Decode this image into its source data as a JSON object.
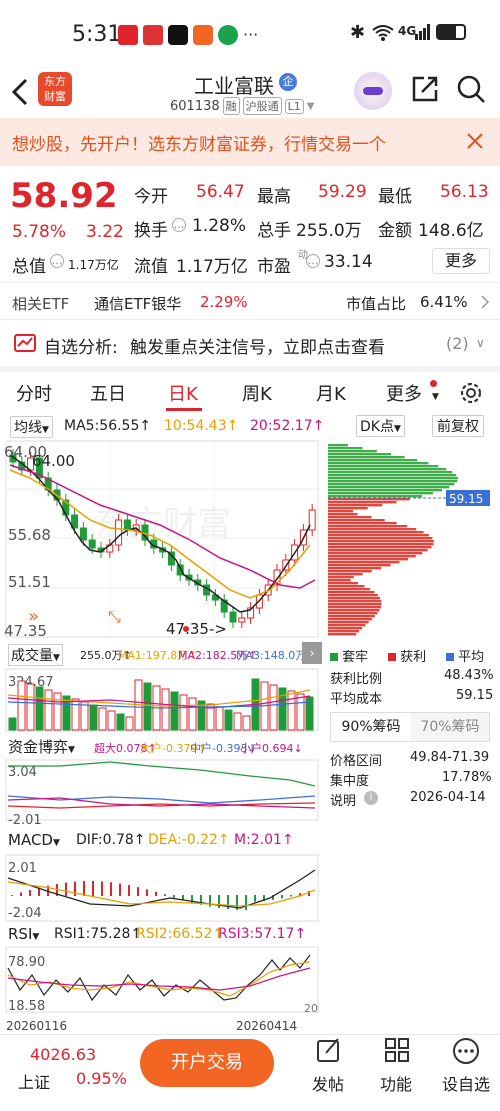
{
  "status": {
    "time": "5:31",
    "signal": "4G",
    "battery": "75"
  },
  "header": {
    "logo_line1": "东方",
    "logo_line2": "财富",
    "title": "工业富联",
    "title_badge": "企",
    "code": "601138",
    "tag_rong": "融",
    "tag_hgt": "沪股通",
    "tag_l1": "L1"
  },
  "banner": {
    "text": "想炒股，先开户！选东方财富证券，行情交易一个"
  },
  "quote": {
    "price": "58.92",
    "pct": "5.78%",
    "chg": "3.22",
    "open_label": "今开",
    "open": "56.47",
    "high_label": "最高",
    "high": "59.29",
    "low_label": "最低",
    "low": "56.13",
    "turn_label": "换手",
    "turn": "1.28%",
    "vol_label": "总手",
    "vol": "255.0万",
    "amt_label": "金额",
    "amt": "148.6亿",
    "mcap_label": "总值",
    "mcap": "1.17万亿",
    "float_label": "流值",
    "float": "1.17万亿",
    "pe_label": "市盈",
    "pe_sup": "动",
    "pe": "33.14",
    "more": "更多"
  },
  "etf": {
    "label": "相关ETF",
    "name": "通信ETF银华",
    "pct": "2.29%",
    "ratio_label": "市值占比",
    "ratio": "6.41%"
  },
  "alert": {
    "title": "自选分析:",
    "text": "触发重点关注信号，立即点击查看",
    "count": "(2)"
  },
  "tabs": [
    {
      "label": "分时"
    },
    {
      "label": "五日"
    },
    {
      "label": "日K"
    },
    {
      "label": "周K"
    },
    {
      "label": "月K"
    },
    {
      "label": "更多"
    }
  ],
  "kline": {
    "ma_label": "均线",
    "ma5": "MA5:56.55↑",
    "ma10": "10:54.43↑",
    "ma20": "20:52.17↑",
    "dk": "DK点",
    "fq": "前复权",
    "y_top": "64.00",
    "y1": "55.68",
    "y2": "51.51",
    "y_bot": "47.35",
    "high_mark": "64.00",
    "low_mark": "47.35->",
    "watermark": "东方财富"
  },
  "volume": {
    "label": "成交量",
    "vol": "255.0万↑",
    "ma1": "MA1:197.8万↑",
    "ma2": "MA2:182.5万↑",
    "ma3": "MA3:148.0万↑",
    "y_top": "324.67"
  },
  "fund": {
    "label": "资金博弈",
    "super": "超大0.078↑",
    "big": "大户-0.379↑",
    "mid": "中户-0.393↓",
    "small": "小户0.694↓",
    "y_top": "3.04",
    "y_bot": "-2.01"
  },
  "macd": {
    "label": "MACD",
    "dif": "DIF:0.78↑",
    "dea": "DEA:-0.22↑",
    "m": "M:2.01↑",
    "y_top": "2.01",
    "y_bot": "-2.04"
  },
  "rsi": {
    "label": "RSI",
    "rsi1": "RSI1:75.28↑",
    "rsi2": "RSI2:66.52↑",
    "rsi3": "RSI3:57.17↑",
    "y_top": "78.90",
    "y_bot": "18.58",
    "right_val": "20"
  },
  "dates": {
    "start": "20260116",
    "end": "20260414"
  },
  "chips": {
    "price_mark": "59.15",
    "legend_trap": "套牢",
    "legend_profit": "获利",
    "legend_avg": "平均",
    "profit_label": "获利比例",
    "profit": "48.43%",
    "avg_label": "平均成本",
    "avg": "59.15",
    "tab90": "90%筹码",
    "tab70": "70%筹码",
    "range_label": "价格区间",
    "range": "49.84-71.39",
    "conc_label": "集中度",
    "conc": "17.78%",
    "note_label": "说明",
    "note_date": "2026-04-14"
  },
  "bottom": {
    "index_val": "4026.63",
    "index_name": "上证",
    "index_pct": "0.95%",
    "trade": "开户交易",
    "post": "发帖",
    "func": "功能",
    "setting": "设自选"
  }
}
